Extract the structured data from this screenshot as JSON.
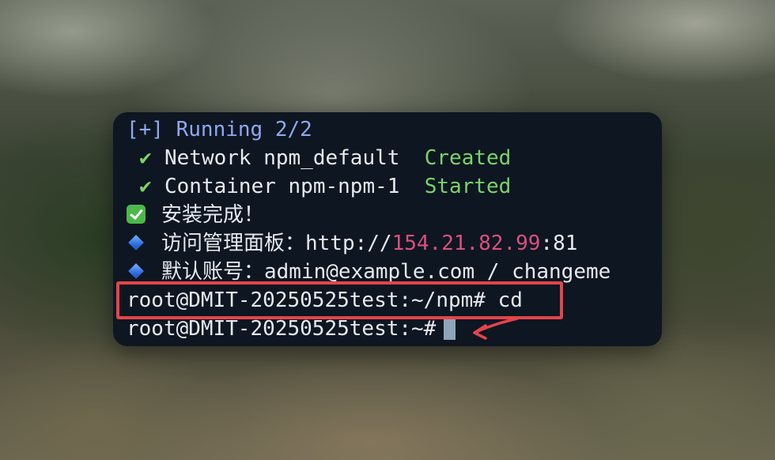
{
  "terminal": {
    "lines": {
      "running": "[+] Running 2/2",
      "network_check": "✔",
      "network_label": "Network npm_default  ",
      "network_status": "Created",
      "container_check": "✔",
      "container_label": "Container npm-npm-1  ",
      "container_status": "Started",
      "install_done": "安装完成！",
      "panel_label": "访问管理面板：http://",
      "panel_host": "154.21.82.99",
      "panel_port": ":81",
      "account": "默认账号：admin@example.com / changeme",
      "prompt_1": "root@DMIT-20250525test:~/npm# cd",
      "prompt_2": "root@DMIT-20250525test:~#"
    }
  },
  "icons": {
    "install_done": "white-check-mark-icon",
    "panel": "blue-diamond-icon",
    "account": "blue-diamond-icon",
    "annotation": "red-arrow-icon"
  },
  "colors": {
    "terminal_bg": "#0e1621",
    "running": "#8ea8f2",
    "status_green": "#78d46a",
    "ip_pink": "#d9507c",
    "annotation_red": "#e2454a"
  }
}
